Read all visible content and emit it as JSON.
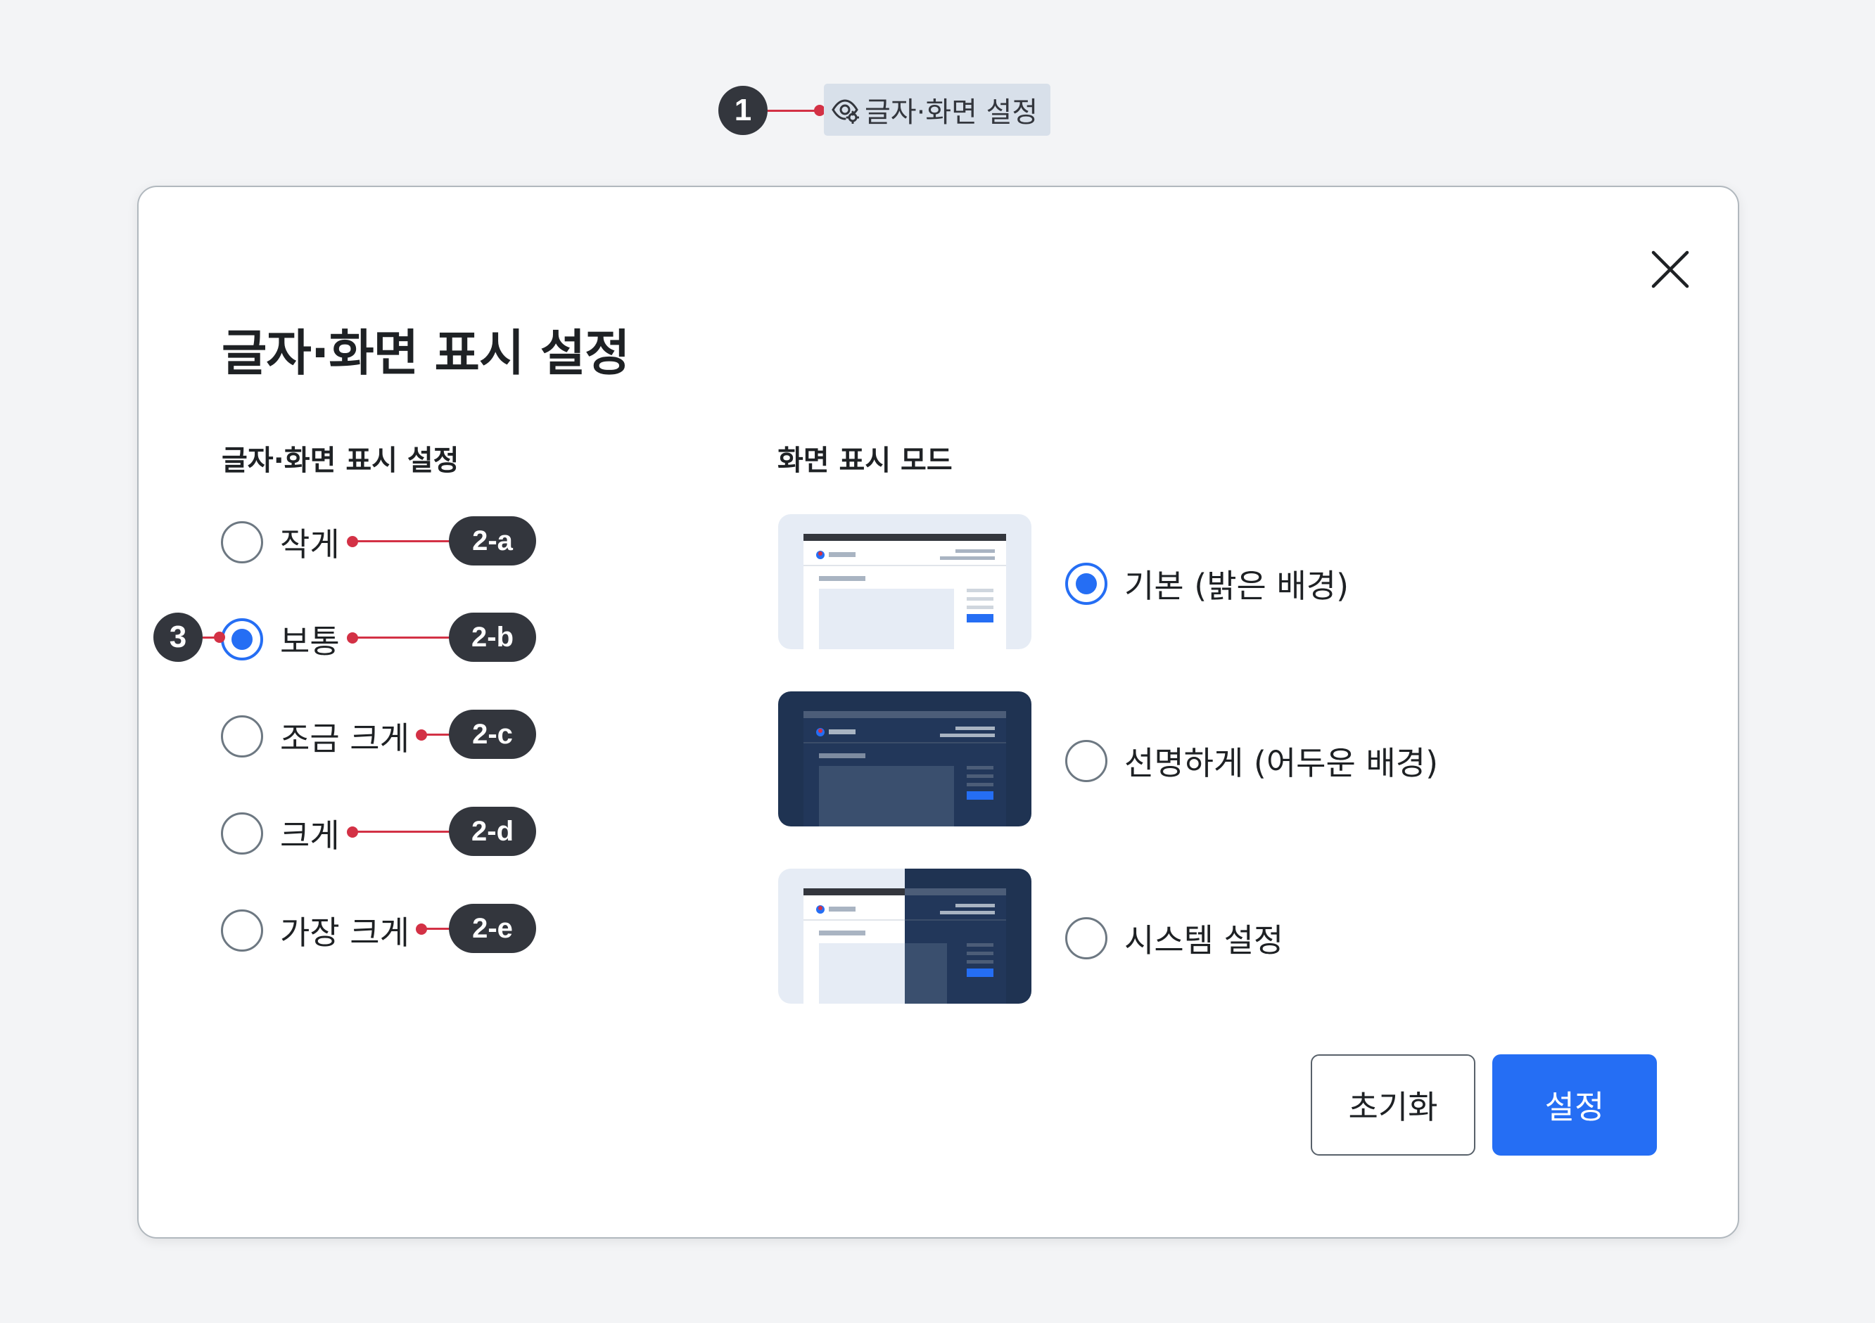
{
  "trigger": {
    "label": "글자·화면 설정",
    "icon": "eye-settings-icon"
  },
  "dialog": {
    "title": "글자·화면 표시 설정",
    "close_icon": "close-icon",
    "font_section": {
      "title": "글자·화면 표시 설정",
      "options": [
        {
          "label": "작게",
          "checked": false,
          "annotation": "2-a"
        },
        {
          "label": "보통",
          "checked": true,
          "annotation": "2-b"
        },
        {
          "label": "조금 크게",
          "checked": false,
          "annotation": "2-c"
        },
        {
          "label": "크게",
          "checked": false,
          "annotation": "2-d"
        },
        {
          "label": "가장 크게",
          "checked": false,
          "annotation": "2-e"
        }
      ]
    },
    "mode_section": {
      "title": "화면 표시 모드",
      "options": [
        {
          "label": "기본 (밝은 배경)",
          "checked": true,
          "preview": "light"
        },
        {
          "label": "선명하게 (어두운 배경)",
          "checked": false,
          "preview": "dark"
        },
        {
          "label": "시스템 설정",
          "checked": false,
          "preview": "system"
        }
      ]
    },
    "buttons": {
      "reset": "초기화",
      "apply": "설정"
    }
  },
  "annotations": {
    "trigger": "1",
    "selected_radio": "3"
  },
  "colors": {
    "primary": "#256ef4",
    "annotation_bg": "#33363d",
    "annotation_line": "#d33145",
    "preview_light_bg": "#e6ecf5",
    "preview_dark_bg": "#1f3352"
  }
}
